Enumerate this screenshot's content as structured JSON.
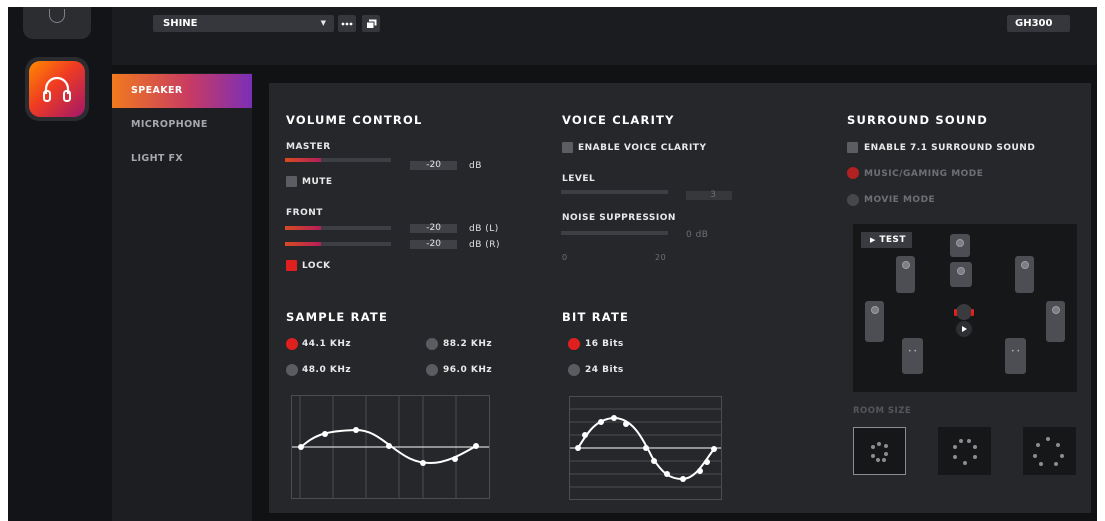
{
  "topbar": {
    "profile": "SHINE",
    "device": "GH300"
  },
  "nav": {
    "items": [
      {
        "label": "SPEAKER"
      },
      {
        "label": "MICROPHONE"
      },
      {
        "label": "LIGHT FX"
      }
    ]
  },
  "volume": {
    "title": "VOLUME CONTROL",
    "master_label": "MASTER",
    "master_value": "-20",
    "master_unit": "dB",
    "mute_label": "MUTE",
    "mute_checked": false,
    "front_label": "FRONT",
    "front_left_value": "-20",
    "front_left_unit": "dB (L)",
    "front_right_value": "-20",
    "front_right_unit": "dB (R)",
    "lock_label": "LOCK",
    "lock_checked": true
  },
  "voice": {
    "title": "VOICE CLARITY",
    "enable_label": "ENABLE VOICE CLARITY",
    "level_label": "LEVEL",
    "level_value": "3",
    "noise_label": "NOISE SUPPRESSION",
    "noise_value": "0 dB",
    "scale_min": "0",
    "scale_max": "20"
  },
  "surround": {
    "title": "SURROUND SOUND",
    "enable_label": "ENABLE 7.1 SURROUND SOUND",
    "music_mode": "MUSIC/GAMING MODE",
    "movie_mode": "MOVIE MODE",
    "test_label": "TEST",
    "room_size_label": "ROOM SIZE"
  },
  "sample_rate": {
    "title": "SAMPLE RATE",
    "options": [
      "44.1 KHz",
      "88.2 KHz",
      "48.0 KHz",
      "96.0 KHz"
    ],
    "selected": "44.1 KHz"
  },
  "bit_rate": {
    "title": "BIT RATE",
    "options": [
      "16 Bits",
      "24 Bits"
    ],
    "selected": "16 Bits"
  },
  "colors": {
    "accent": "#e0201e",
    "panel": "#26272b",
    "gradient_start": "#f17a1e",
    "gradient_end": "#7a2fb7"
  }
}
